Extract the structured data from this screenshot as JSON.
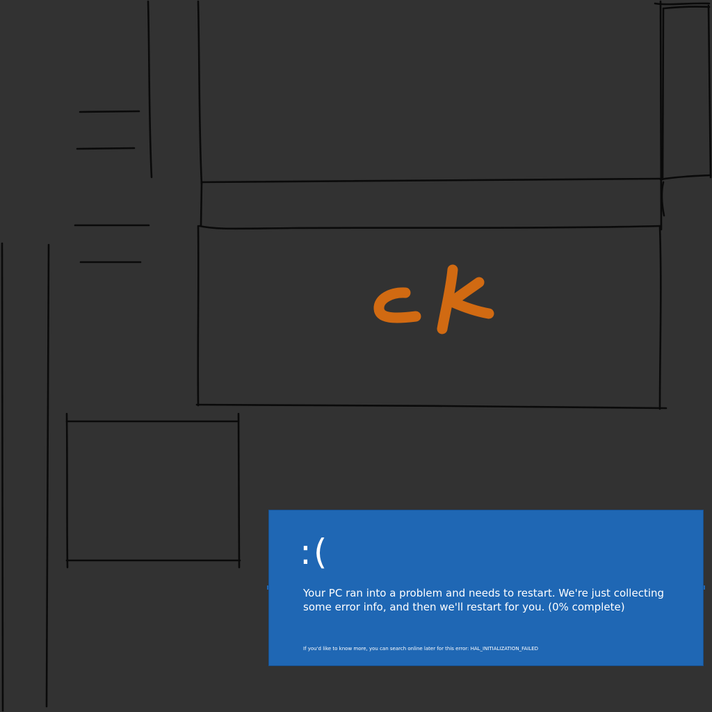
{
  "sketch": {
    "annotation": "ck",
    "annotation_color": "#d16a12",
    "line_color": "#0a0a0a",
    "background": "#323232"
  },
  "error_screen": {
    "background": "#1f67b4",
    "face": ":(",
    "message": "Your PC ran into a problem and needs to restart. We're just collecting some error info, and then we'll restart for you. (0% complete)",
    "more_info": "If you'd like to know more, you can search online later for this error: HAL_INITIALIZATION_FAILED"
  }
}
